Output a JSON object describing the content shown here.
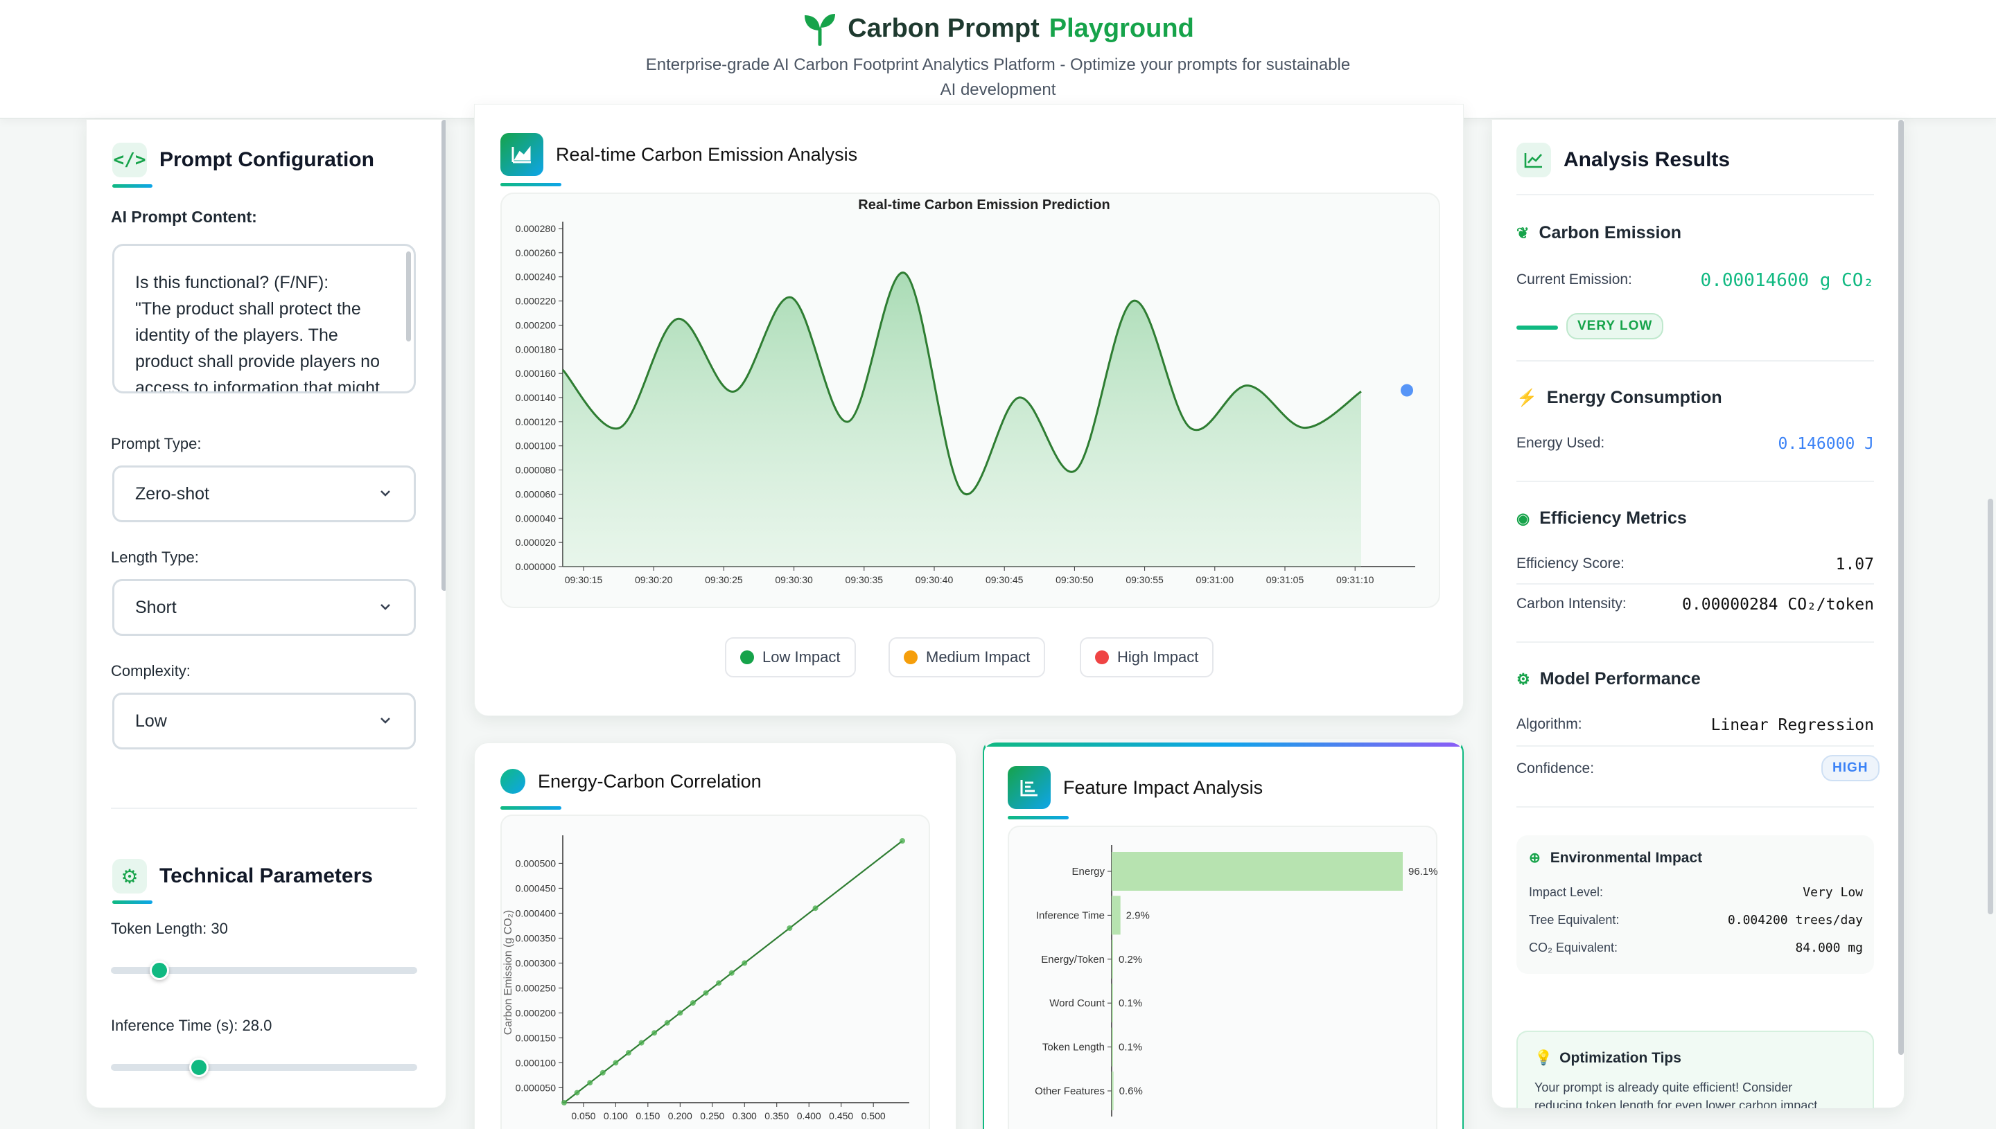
{
  "app": {
    "title_part1": "Carbon Prompt",
    "title_part2": "Playground",
    "subtitle_line1": "Enterprise-grade AI Carbon Footprint Analytics Platform - Optimize your prompts for sustainable",
    "subtitle_line2": "AI development",
    "logo_icon": "sprout-icon"
  },
  "config": {
    "title": "Prompt Configuration",
    "prompt_label": "AI Prompt Content:",
    "prompt_lines": [
      "Is this functional? (F/NF):",
      "\"The product shall protect the",
      "identity of the players. The",
      "product shall provide players no",
      "access to information that might"
    ],
    "prompt_type_label": "Prompt Type:",
    "prompt_type_value": "Zero-shot",
    "length_type_label": "Length Type:",
    "length_type_value": "Short",
    "complexity_label": "Complexity:",
    "complexity_value": "Low"
  },
  "technical": {
    "title": "Technical Parameters",
    "token_label": "Token Length: 30",
    "token_value": 30,
    "inference_label": "Inference Time (s): 28.0",
    "inference_value": 28.0
  },
  "realtime": {
    "panel_title": "Real-time Carbon Emission Analysis",
    "legend": [
      {
        "label": "Low Impact",
        "color": "#16a34a"
      },
      {
        "label": "Medium Impact",
        "color": "#f59e0b"
      },
      {
        "label": "High Impact",
        "color": "#ef4444"
      }
    ]
  },
  "correlation": {
    "panel_title": "Energy-Carbon Correlation"
  },
  "feature": {
    "panel_title": "Feature Impact Analysis"
  },
  "chart_data": [
    {
      "type": "area",
      "title": "Real-time Carbon Emission Prediction",
      "x": [
        "09:30:15",
        "09:30:20",
        "09:30:25",
        "09:30:30",
        "09:30:35",
        "09:30:40",
        "09:30:45",
        "09:30:50",
        "09:30:55",
        "09:31:00",
        "09:31:05",
        "09:31:10"
      ],
      "values": [
        0.000163,
        0.000115,
        0.000205,
        0.000145,
        0.000223,
        0.00012,
        0.000243,
        6.2e-05,
        0.00014,
        8e-05,
        0.00022,
        0.000115,
        0.00015,
        0.000115,
        0.000145
      ],
      "yticks": [
        "0.000000",
        "0.000020",
        "0.000040",
        "0.000060",
        "0.000080",
        "0.000100",
        "0.000120",
        "0.000140",
        "0.000160",
        "0.000180",
        "0.000200",
        "0.000220",
        "0.000240",
        "0.000260",
        "0.000280"
      ],
      "ylim": [
        0,
        0.00028
      ],
      "last_point": 0.000146,
      "color": "#2e7d32"
    },
    {
      "type": "scatter",
      "ylabel": "Carbon Emission (g CO₂)",
      "xticks": [
        "0.050",
        "0.100",
        "0.150",
        "0.200",
        "0.250",
        "0.300",
        "0.350",
        "0.400",
        "0.450",
        "0.500"
      ],
      "yticks": [
        "0.000050",
        "0.000100",
        "0.000150",
        "0.000200",
        "0.000250",
        "0.000300",
        "0.000350",
        "0.000400",
        "0.000450",
        "0.000500"
      ],
      "points": [
        [
          0.02,
          2e-05
        ],
        [
          0.04,
          4e-05
        ],
        [
          0.06,
          6e-05
        ],
        [
          0.08,
          8e-05
        ],
        [
          0.1,
          0.0001
        ],
        [
          0.12,
          0.00012
        ],
        [
          0.14,
          0.00014
        ],
        [
          0.16,
          0.00016
        ],
        [
          0.18,
          0.00018
        ],
        [
          0.2,
          0.0002
        ],
        [
          0.22,
          0.00022
        ],
        [
          0.24,
          0.00024
        ],
        [
          0.26,
          0.00026
        ],
        [
          0.28,
          0.00028
        ],
        [
          0.3,
          0.0003
        ],
        [
          0.37,
          0.00037
        ],
        [
          0.41,
          0.00041
        ],
        [
          0.545,
          0.000545
        ]
      ],
      "color": "#2e7d32"
    },
    {
      "type": "bar",
      "orientation": "horizontal",
      "categories": [
        "Energy",
        "Inference Time",
        "Energy/Token",
        "Word Count",
        "Token Length",
        "Other Features"
      ],
      "values": [
        96.1,
        2.9,
        0.2,
        0.1,
        0.1,
        0.6
      ],
      "labels": [
        "96.1%",
        "2.9%",
        "0.2%",
        "0.1%",
        "0.1%",
        "0.6%"
      ],
      "color": "#b7e3b0"
    }
  ],
  "results": {
    "title": "Analysis Results",
    "carbon_title": "Carbon Emission",
    "current_emission_label": "Current Emission:",
    "current_emission_value": "0.00014600 g CO₂",
    "emission_badge": "VERY LOW",
    "energy_title": "Energy Consumption",
    "energy_used_label": "Energy Used:",
    "energy_used_value": "0.146000 J",
    "efficiency_title": "Efficiency Metrics",
    "efficiency_score_label": "Efficiency Score:",
    "efficiency_score_value": "1.07",
    "carbon_intensity_label": "Carbon Intensity:",
    "carbon_intensity_value": "0.00000284 CO₂/token",
    "model_title": "Model Performance",
    "algorithm_label": "Algorithm:",
    "algorithm_value": "Linear Regression",
    "confidence_label": "Confidence:",
    "confidence_value": "HIGH",
    "env_title": "Environmental Impact",
    "impact_level_label": "Impact Level:",
    "impact_level_value": "Very Low",
    "tree_label": "Tree Equivalent:",
    "tree_value": "0.004200 trees/day",
    "co2_label": "CO₂ Equivalent:",
    "co2_value": "84.000 mg",
    "tips_title": "Optimization Tips",
    "tips_line1": "Your prompt is already quite efficient! Consider",
    "tips_line2": "reducing token length for even lower carbon impact."
  },
  "colors": {
    "accent": "#16a34a",
    "accent_teal": "#10b981",
    "blue": "#0ea5e9",
    "chart_line": "#2e7d32"
  }
}
